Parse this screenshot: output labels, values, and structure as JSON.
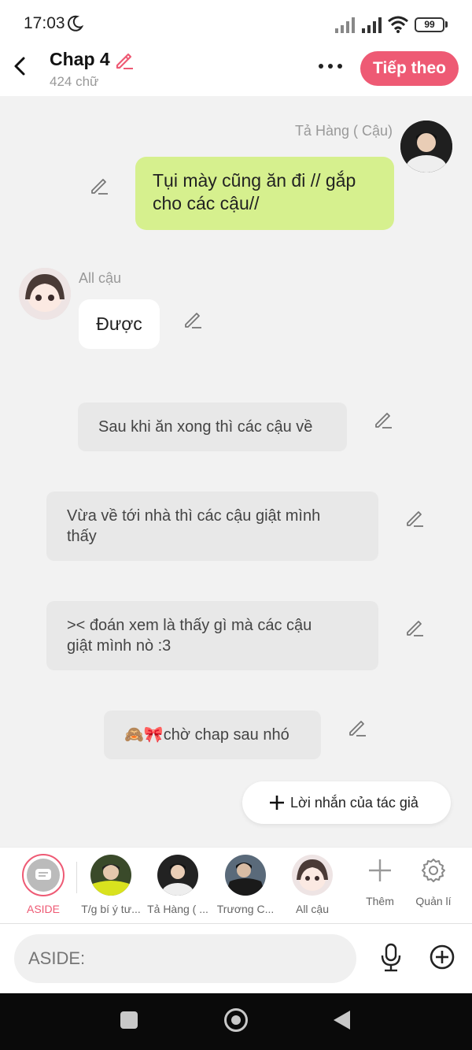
{
  "status_bar": {
    "time": "17:03",
    "battery": "99"
  },
  "header": {
    "title": "Chap 4",
    "word_count": "424 chữ",
    "next_label": "Tiếp theo"
  },
  "messages": [
    {
      "type": "dialogue",
      "side": "right",
      "sender": "Tả Hàng ( Cậu)",
      "text_lines": [
        "Tụi mày cũng ăn đi // gắp",
        "cho các cậu//"
      ]
    },
    {
      "type": "dialogue",
      "side": "left",
      "sender": "All cậu",
      "text": "Được"
    },
    {
      "type": "aside",
      "text_lines": [
        "Sau khi ăn xong thì các cậu về"
      ]
    },
    {
      "type": "aside",
      "text_lines": [
        "Vừa về tới nhà thì các cậu giật mình",
        "thấy"
      ]
    },
    {
      "type": "aside",
      "text_lines": [
        "><  đoán xem là thấy gì mà các cậu",
        "giật mình nò :3"
      ]
    },
    {
      "type": "aside",
      "text_lines": [
        "🙈🎀chờ chap sau nhó"
      ]
    }
  ],
  "author_note_label": "Lời nhắn của tác giả",
  "characters": [
    {
      "label": "ASIDE",
      "selected": true
    },
    {
      "label": "T/g bí ý tư..."
    },
    {
      "label": "Tả Hàng ( ..."
    },
    {
      "label": "Trương C..."
    },
    {
      "label": "All cậu"
    }
  ],
  "tools": [
    {
      "label": "Thêm",
      "icon": "plus-icon"
    },
    {
      "label": "Quản lí",
      "icon": "gear-icon"
    }
  ],
  "input": {
    "placeholder": "ASIDE:"
  },
  "colors": {
    "accent": "#ee5a74",
    "green_bubble": "#d6f08e",
    "aside_bubble": "#e8e8e8",
    "background": "#f2f2f2"
  }
}
